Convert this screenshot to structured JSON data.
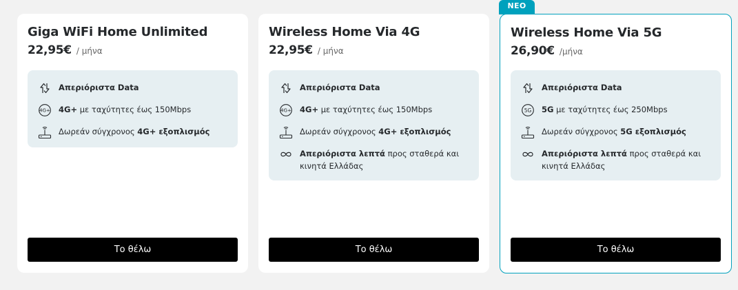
{
  "plans": [
    {
      "title": "Giga WiFi Home Unlimited",
      "price": "22,95€",
      "period": "/ μήνα",
      "badge": "",
      "features": [
        {
          "icon": "data-arrows-icon",
          "bold1": "Απεριόριστα Data",
          "text1": "",
          "bold2": "",
          "text2": ""
        },
        {
          "icon": "4g-plus-icon",
          "bold1": "4G+",
          "text1": " με ταχύτητες έως 150Mbps",
          "bold2": "",
          "text2": ""
        },
        {
          "icon": "router-icon",
          "bold1": "",
          "text1": "Δωρεάν σύγχρονος ",
          "bold2": "4G+ εξοπλισμός",
          "text2": ""
        }
      ],
      "button": "Το θέλω"
    },
    {
      "title": "Wireless Home Via 4G",
      "price": "22,95€",
      "period": "/ μήνα",
      "badge": "",
      "features": [
        {
          "icon": "data-arrows-icon",
          "bold1": "Απεριόριστα Data",
          "text1": "",
          "bold2": "",
          "text2": ""
        },
        {
          "icon": "4g-plus-icon",
          "bold1": "4G+",
          "text1": " με ταχύτητες έως 150Mbps",
          "bold2": "",
          "text2": ""
        },
        {
          "icon": "router-icon",
          "bold1": "",
          "text1": "Δωρεάν σύγχρονος ",
          "bold2": "4G+ εξοπλισμός",
          "text2": ""
        },
        {
          "icon": "infinity-icon",
          "bold1": "Απεριόριστα λεπτά",
          "text1": " προς σταθερά και κινητά Ελλάδας",
          "bold2": "",
          "text2": ""
        }
      ],
      "button": "Το θέλω"
    },
    {
      "title": "Wireless Home Via 5G",
      "price": "26,90€",
      "period": "/μήνα",
      "badge": "ΝΕΟ",
      "features": [
        {
          "icon": "data-arrows-icon",
          "bold1": "Απεριόριστα Data",
          "text1": "",
          "bold2": "",
          "text2": ""
        },
        {
          "icon": "5g-icon",
          "bold1": "5G",
          "text1": " με ταχύτητες έως 250Mbps",
          "bold2": "",
          "text2": ""
        },
        {
          "icon": "router-icon",
          "bold1": "",
          "text1": "Δωρεάν σύγχρονος ",
          "bold2": "5G εξοπλισμός",
          "text2": ""
        },
        {
          "icon": "infinity-icon",
          "bold1": "Απεριόριστα λεπτά",
          "text1": " προς σταθερά και κινητά Ελλάδας",
          "bold2": "",
          "text2": ""
        }
      ],
      "button": "Το θέλω"
    }
  ],
  "colors": {
    "accent": "#00a1bd",
    "feature_bg": "#e6eff2",
    "button_bg": "#000000",
    "page_bg": "#f2f2f2"
  }
}
